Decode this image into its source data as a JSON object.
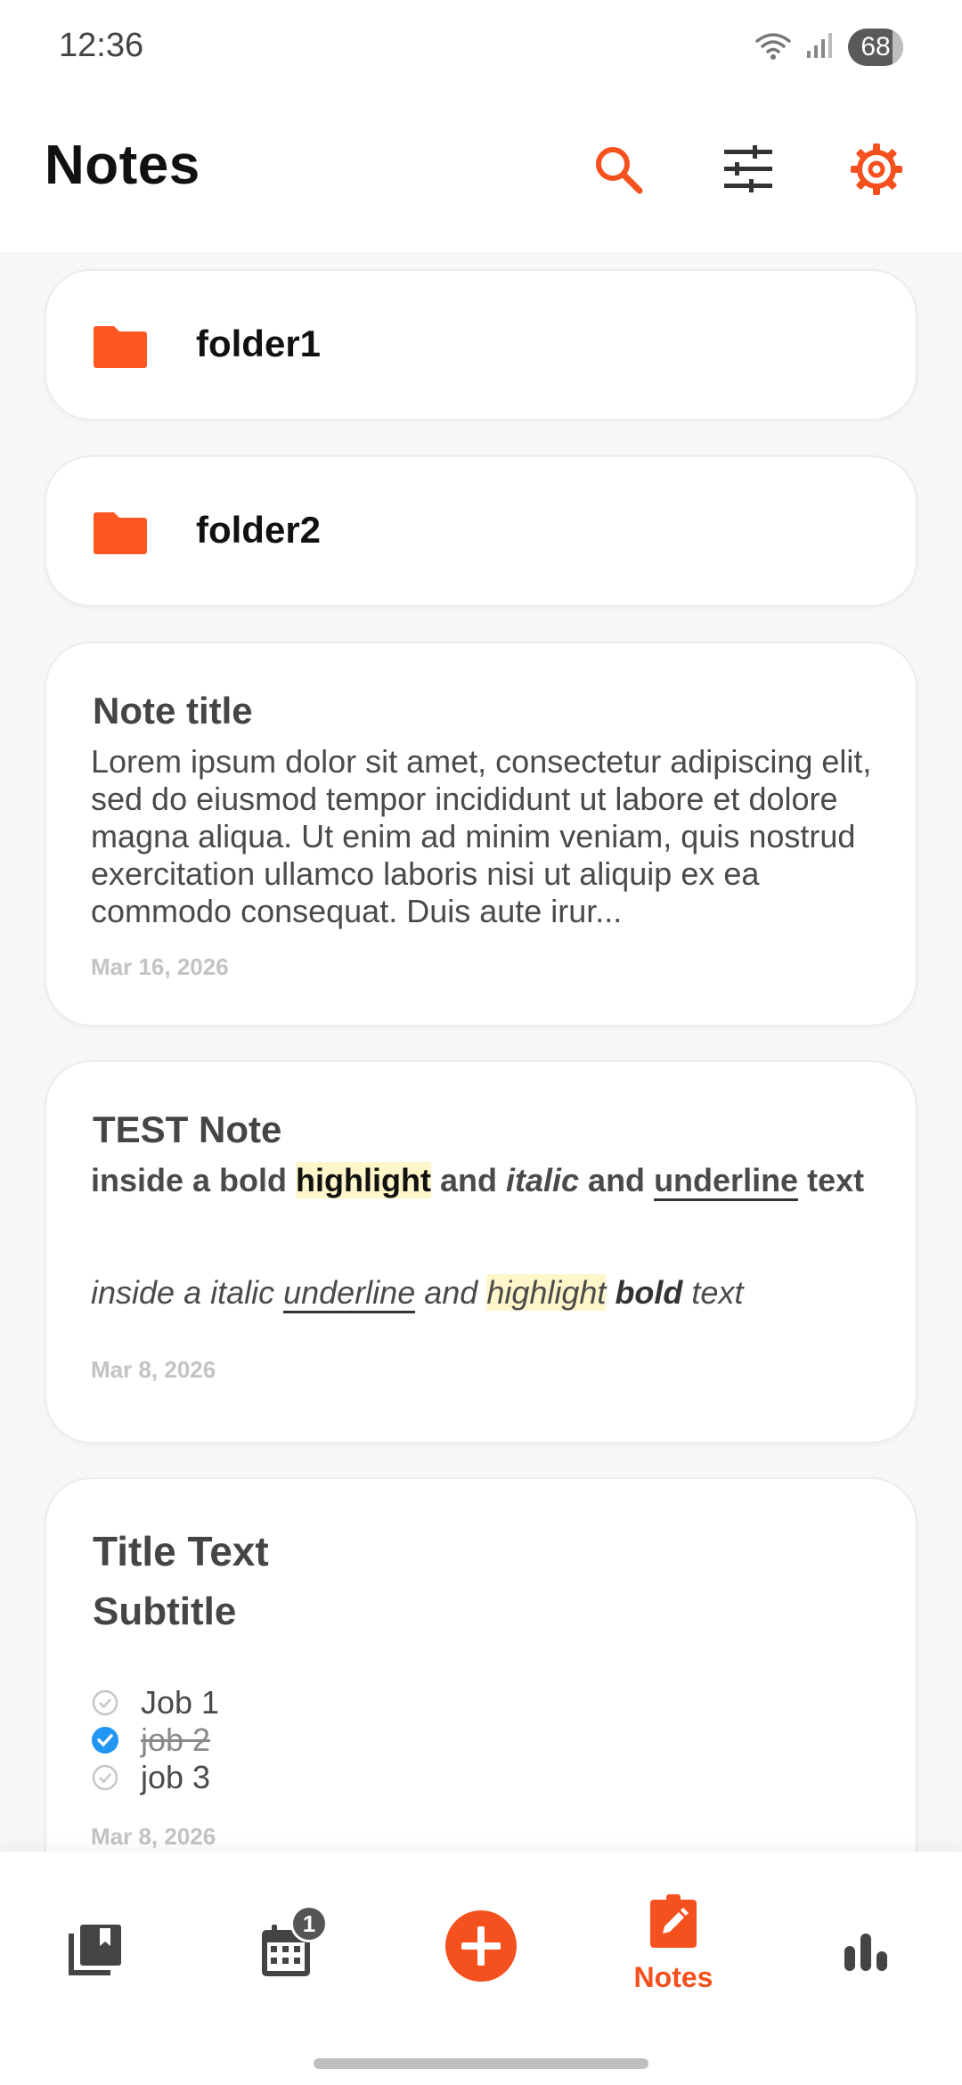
{
  "colors": {
    "accent": "#f4511e",
    "icon_dark": "#444444",
    "highlight": "#fff6c9",
    "check_blue": "#2196f3"
  },
  "status_bar": {
    "time": "12:36",
    "battery": "68",
    "icons": [
      "wifi-icon",
      "signal-icon",
      "battery-icon"
    ]
  },
  "header": {
    "title": "Notes",
    "icons": [
      "search-icon",
      "filter-sliders-icon",
      "settings-gear-icon"
    ]
  },
  "folders": [
    {
      "name": "folder1",
      "icon": "folder-icon"
    },
    {
      "name": "folder2",
      "icon": "folder-icon"
    }
  ],
  "notes": [
    {
      "title": "Note title",
      "body": "Lorem ipsum dolor sit amet, consectetur adipiscing elit, sed do eiusmod tempor incididunt ut labore et dolore magna aliqua. Ut enim ad minim veniam, quis nostrud exercitation ullamco laboris nisi ut aliquip ex ea commodo consequat. Duis aute irur...",
      "date": "Mar 16, 2026"
    },
    {
      "title": "TEST Note",
      "line1": {
        "t1": "inside a bold ",
        "t2": "highlight",
        "t3": " and ",
        "t4": "italic",
        "t5": " and ",
        "t6": "underline",
        "t7": " text"
      },
      "line2": {
        "t1": "inside a italic ",
        "t2": "underline",
        "t3": " and ",
        "t4": "highlight",
        "t5": " ",
        "t6": "bold",
        "t7": " text"
      },
      "date": "Mar 8, 2026"
    },
    {
      "title": "Title Text",
      "subtitle": "Subtitle",
      "checklist": [
        {
          "label": "Job 1",
          "checked": false
        },
        {
          "label": "job 2",
          "checked": true
        },
        {
          "label": "job 3",
          "checked": false
        }
      ],
      "date": "Mar 8, 2026"
    }
  ],
  "bottom_nav": {
    "items": [
      {
        "icon": "library-books-icon"
      },
      {
        "icon": "calendar-icon",
        "badge": "1"
      },
      {
        "icon": "add-circle-icon"
      },
      {
        "icon": "edit-note-icon",
        "label": "Notes",
        "active": true
      },
      {
        "icon": "bar-chart-icon"
      }
    ]
  }
}
